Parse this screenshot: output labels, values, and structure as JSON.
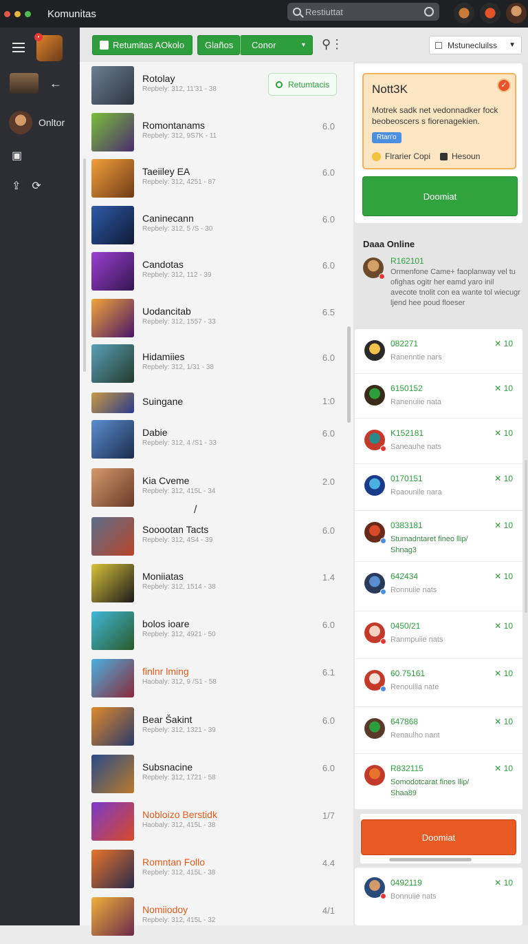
{
  "window": {
    "title": "Komunitas",
    "colors": {
      "close": "#e2574c",
      "minimize": "#e6b73a",
      "zoom": "#4fbf55"
    },
    "search_placeholder": "Restiuttat"
  },
  "sidebar": {
    "online_label": "Onltor"
  },
  "toolbar": {
    "primary_label": "Retumitas AOkolo",
    "tab_label": "Glaños",
    "select_label": "Conor",
    "sort_label": "Mstunecluilss"
  },
  "list": {
    "return_label": "Retumtacis",
    "items": [
      {
        "name": "Rotolay",
        "meta": "Repbely: 312, 11'31 - 38",
        "score": "",
        "orange": false,
        "c1": "#6d7f92",
        "c2": "#2b3540"
      },
      {
        "name": "Romontanams",
        "meta": "Repbely: 312, 9S7K - 11",
        "score": "6.0",
        "orange": false,
        "c1": "#7bbf3a",
        "c2": "#4b2c6e"
      },
      {
        "name": "Taeiiley EA",
        "meta": "Repbely: 312, 4251 - 87",
        "score": "6.0",
        "orange": false,
        "c1": "#f3a13a",
        "c2": "#6e3a16"
      },
      {
        "name": "Caninecann",
        "meta": "Repbely: 312, 5 /S - 30",
        "score": "6.0",
        "orange": false,
        "c1": "#2d5ba8",
        "c2": "#101a36"
      },
      {
        "name": "Candotas",
        "meta": "Repbely: 312, 112 - 39",
        "score": "6.0",
        "orange": false,
        "c1": "#9c3fd1",
        "c2": "#331651"
      },
      {
        "name": "Uodancitab",
        "meta": "Repbely: 312, 1557 - 33",
        "score": "6.5",
        "orange": false,
        "c1": "#f0a53a",
        "c2": "#4a1566"
      },
      {
        "name": "Hidamiies",
        "meta": "Repbely: 312, 1/31 - 38",
        "score": "6.0",
        "orange": false,
        "c1": "#5aa0b8",
        "c2": "#233b2c"
      },
      {
        "name": "Suingane",
        "meta": "",
        "score": "1:0",
        "orange": false,
        "c1": "#c79a44",
        "c2": "#2a3a8a"
      },
      {
        "name": "Dabie",
        "meta": "Repbely: 312, 4 /S1 - 33",
        "score": "6.0",
        "orange": false,
        "c1": "#5a8ed0",
        "c2": "#1c2c4c"
      },
      {
        "name": "Kia Cveme",
        "meta": "Repbely: 312, 415L - 34",
        "score": "2.0",
        "orange": false,
        "c1": "#d49a6a",
        "c2": "#6a3a2a"
      },
      {
        "name": "Sooootan Tacts",
        "meta": "Repbely: 312, 4S4 - 39",
        "score": "6.0",
        "orange": false,
        "c1": "#5a6e8a",
        "c2": "#b8452a"
      },
      {
        "name": "Moniiatas",
        "meta": "Repbely: 312, 1514 - 38",
        "score": "1.4",
        "orange": false,
        "c1": "#d8c23a",
        "c2": "#1a1a1a"
      },
      {
        "name": "bolos ioare",
        "meta": "Repbely: 312, 4921 - 50",
        "score": "6.0",
        "orange": false,
        "c1": "#3fb8d8",
        "c2": "#2a5a2a"
      },
      {
        "name": "finlnr lming",
        "meta": "Haobaly: 312, 9 /S1 - 58",
        "score": "6.1",
        "orange": true,
        "c1": "#4ab0e0",
        "c2": "#8a2a3a"
      },
      {
        "name": "Bear Šakint",
        "meta": "Repbely: 312, 1321 - 39",
        "score": "6.0",
        "orange": false,
        "c1": "#e08a2a",
        "c2": "#2a3a6a"
      },
      {
        "name": "Subsnacine",
        "meta": "Repbely: 312, 1721 - 58",
        "score": "6.0",
        "orange": false,
        "c1": "#2a4a8a",
        "c2": "#b87a2a"
      },
      {
        "name": "Nobloizo Berstidk",
        "meta": "Haobaly: 312, 415L - 38",
        "score": "1/7",
        "orange": true,
        "c1": "#7a3ac8",
        "c2": "#d84a2a"
      },
      {
        "name": "Romntan Follo",
        "meta": "Repbely: 312, 415L - 38",
        "score": "4.4",
        "orange": true,
        "c1": "#e8742a",
        "c2": "#2a2a4a"
      },
      {
        "name": "Nomiiodoy",
        "meta": "Repbely: 312, 415L - 32",
        "score": "4/1",
        "orange": true,
        "c1": "#f0b03a",
        "c2": "#6a2a4a"
      }
    ]
  },
  "notice": {
    "title": "Nott3K",
    "body": "Motrek sadk net vedonnadker fock beobeoscers s fiorenagekien.",
    "tag": "Rtan'o",
    "footer_left": "Flrarier Copi",
    "footer_right": "Hesoun"
  },
  "download_label": "Doomiat",
  "online": {
    "title": "Daaa Online",
    "top_name": "R162101",
    "top_message": "Ormenfone Came+ faoplanway vel tu ofighas ogitr her eamd yaro inil avecote tnolit con ea wante tol wiecugr ljend hee poud floeser"
  },
  "friends": [
    {
      "name": "082271",
      "status": "Ranenntie nars",
      "count": "✕ 10",
      "green": false,
      "c1": "#f2c24a",
      "c2": "#2a2a2a",
      "dot": ""
    },
    {
      "name": "6150152",
      "status": "Ranenuiie nata",
      "count": "✕ 10",
      "green": false,
      "c1": "#2e9e3d",
      "c2": "#3a2a1a",
      "dot": ""
    },
    {
      "name": "K152181",
      "status": "Saneauhe nats",
      "count": "✕ 10",
      "green": false,
      "c1": "#2a8a8a",
      "c2": "#c43a2a",
      "dot": "#e53935"
    },
    {
      "name": "0170151",
      "status": "Roaounile nara",
      "count": "✕ 10",
      "green": false,
      "c1": "#4ab0e0",
      "c2": "#1a3a8a",
      "dot": ""
    },
    {
      "name": "0383181",
      "status": "Stumadntaret fineo llip/ Shnag3",
      "count": "✕ 10",
      "green": true,
      "c1": "#d84a2a",
      "c2": "#6a2a1a",
      "dot": "#4c8fe0"
    },
    {
      "name": "642434",
      "status": "Ronnuiie nats",
      "count": "✕ 10",
      "green": false,
      "c1": "#5a8ed0",
      "c2": "#2a3a5a",
      "dot": "#4c8fe0"
    },
    {
      "name": "0450/21",
      "status": "Ranmpuiie nats",
      "count": "✕ 10",
      "green": false,
      "c1": "#f4d0c0",
      "c2": "#c43a2a",
      "dot": "#e53935"
    },
    {
      "name": "60.75161",
      "status": "Renouilia nate",
      "count": "✕ 10",
      "green": false,
      "c1": "#f2e2da",
      "c2": "#c43a2a",
      "dot": "#4c8fe0"
    },
    {
      "name": "647868",
      "status": "Renaulho nant",
      "count": "✕ 10",
      "green": false,
      "c1": "#2e9e3d",
      "c2": "#5a3a2a",
      "dot": ""
    },
    {
      "name": "R832115",
      "status": "Somodotcarat fines llip/ Shaa89",
      "count": "✕ 10",
      "green": true,
      "c1": "#e8742a",
      "c2": "#c43a2a",
      "dot": ""
    }
  ],
  "bottom_friend": {
    "name": "0492119",
    "status": "Bonnuiie nats",
    "count": "✕ 10"
  }
}
